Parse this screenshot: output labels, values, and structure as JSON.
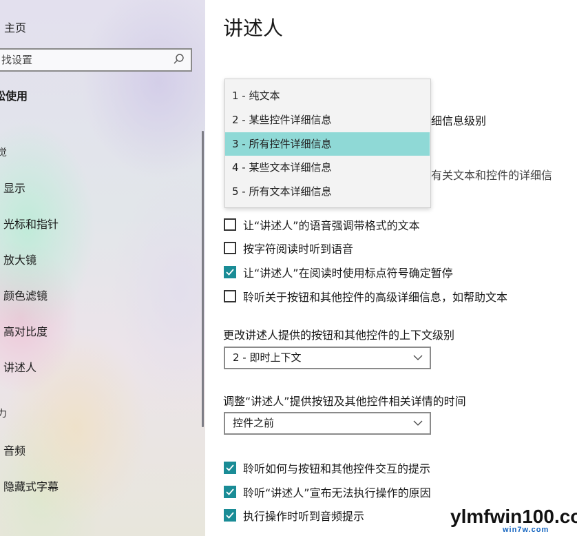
{
  "sidebar": {
    "home": "主页",
    "search_placeholder": "找设置",
    "section": "松使用",
    "category_vision": "觉",
    "category_hearing": "力",
    "items": [
      "显示",
      "光标和指针",
      "放大镜",
      "颜色滤镜",
      "高对比度",
      "讲述人",
      "音频",
      "隐藏式字幕"
    ]
  },
  "main": {
    "title": "讲述人",
    "partial_detail_level": "细信息级别",
    "partial_context_text": "有关文本和控件的详细信",
    "dropdown_options": [
      "1 - 纯文本",
      "2 - 某些控件详细信息",
      "3 - 所有控件详细信息",
      "4 - 某些文本详细信息",
      "5 - 所有文本详细信息"
    ],
    "dropdown_selected_index": 2,
    "checkboxes_top": [
      {
        "label": "让“讲述人”的语音强调带格式的文本",
        "checked": false
      },
      {
        "label": "按字符阅读时听到语音",
        "checked": false
      },
      {
        "label": "让“讲述人”在阅读时使用标点符号确定暂停",
        "checked": true
      },
      {
        "label": "聆听关于按钮和其他控件的高级详细信息，如帮助文本",
        "checked": false
      }
    ],
    "context_label": "更改讲述人提供的按钮和其他控件的上下文级别",
    "context_value": "2 - 即时上下文",
    "timing_label": "调整“讲述人”提供按钮及其他控件相关详情的时间",
    "timing_value": "控件之前",
    "checkboxes_bottom": [
      {
        "label": "聆听如何与按钮和其他控件交互的提示",
        "checked": true
      },
      {
        "label": "聆听“讲述人”宣布无法执行操作的原因",
        "checked": true
      },
      {
        "label": "执行操作时听到音频提示",
        "checked": true
      }
    ]
  },
  "watermark": {
    "text": "ylmfwin100.com",
    "sub": "win7w.com"
  },
  "colors": {
    "accent": "#1a8c96",
    "selected_option": "#8fd9d6"
  }
}
